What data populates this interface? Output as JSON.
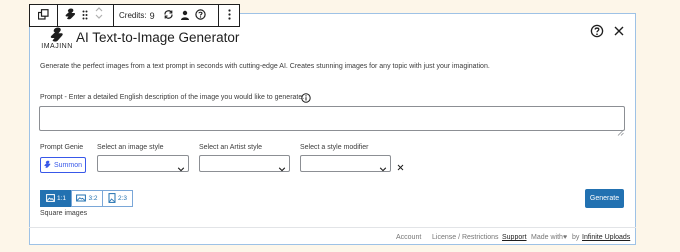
{
  "toolbar": {
    "credits_label": "Credits:",
    "credits_value": "9",
    "icons": [
      "duplicate-icon",
      "imajinn-block-icon",
      "drag-handle-icon",
      "move-up-down-icon",
      "refresh-icon",
      "account-icon",
      "help-icon",
      "more-options-icon"
    ]
  },
  "header": {
    "logo_text": "IMAJINN",
    "title": "AI Text-to-Image Generator"
  },
  "description": "Generate the perfect images from a text prompt in seconds with cutting-edge AI. Creates stunning images for any topic with just your imagination.",
  "prompt": {
    "label": "Prompt - Enter a detailed English description of the image you would like to generate.",
    "value": "",
    "placeholder": ""
  },
  "controls": {
    "genie_label": "Prompt Genie",
    "summon_label": "Summon",
    "image_style_label": "Select an image style",
    "image_style_value": "",
    "artist_style_label": "Select an Artist style",
    "artist_style_value": "",
    "modifier_label": "Select a style modifier",
    "modifier_value": ""
  },
  "aspect_ratios": {
    "options": [
      "1:1",
      "3:2",
      "2:3"
    ],
    "selected": "1:1",
    "caption": "Square images"
  },
  "generate_label": "Generate",
  "footer": {
    "account": "Account",
    "license": "License / Restrictions",
    "support": "Support",
    "made_with": "Made with",
    "by": "by",
    "company": "Infinite Uploads"
  },
  "colors": {
    "accent": "#2271b1",
    "summon_blue": "#3858e9",
    "background": "#fdf6e9",
    "panel_border": "#9ec2e6"
  }
}
